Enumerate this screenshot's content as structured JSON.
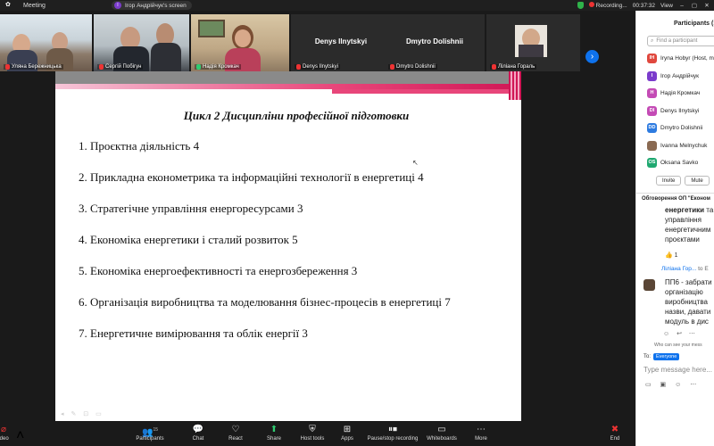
{
  "window": {
    "title": "Meeting",
    "share_label": "Ігор Андрійчук's screen",
    "share_initial": "I",
    "recording": "Recording...",
    "timer": "00:37:32",
    "view": "View"
  },
  "thumbnails": [
    {
      "name": "Уляна Бережницька"
    },
    {
      "name": "Сергій Побігун"
    },
    {
      "name": "Надія Кромкач"
    },
    {
      "name": "Denys Ilnytskyi",
      "big": "Denys Ilnytskyi"
    },
    {
      "name": "Dmytro Dolishnii",
      "big": "Dmytro Dolishnii"
    },
    {
      "name": "Ліліана Гораль"
    }
  ],
  "slide": {
    "title": "Цикл 2 Дисципліни професійної підготовки",
    "items": [
      "1. Проєктна діяльність 4",
      "2. Прикладна економетрика та інформаційні технології в енергетиці 4",
      "3. Стратегічне управління енергоресурсами 3",
      "4. Економіка енергетики і  сталий розвиток 5",
      "5. Економіка енергоефективності та енергозбереження 3",
      "6. Організація виробництва та моделювання бізнес-процесів в енергетиці 7",
      "7. Енергетичне вимірювання та облік енергії 3"
    ]
  },
  "participants": {
    "title": "Participants (15",
    "search_placeholder": "Find a participant",
    "list": [
      {
        "initials": "IH",
        "name": "Iryna Hobyr (Host, m",
        "color": "#e0483e"
      },
      {
        "initials": "I",
        "name": "Ігор Андрійчук",
        "color": "#7b3ccc"
      },
      {
        "initials": "Н",
        "name": "Надія Кромкач",
        "color": "#c44bb5"
      },
      {
        "initials": "DI",
        "name": "Denys Ilnytskyi",
        "color": "#c44bb5"
      },
      {
        "initials": "DD",
        "name": "Dmytro Dolishnii",
        "color": "#2d7be0"
      },
      {
        "initials": "",
        "name": "Ivanna Melnychuk",
        "color": "#8a6a52"
      },
      {
        "initials": "OS",
        "name": "Oksana Savko",
        "color": "#1fa870"
      }
    ],
    "invite": "Invite",
    "mute": "Mute"
  },
  "chat": {
    "title": "Обговорення ОП \"Економ",
    "msg1_bold": "енергетики",
    "msg1_bold_tail": " та",
    "msg1_rest": [
      "управління",
      "енергетичним",
      "проєктами"
    ],
    "reaction": "👍 1",
    "sender": "Ліліана Гор...",
    "sender_to": "to E",
    "msg2": [
      "ПП6 - забрати",
      "організацію",
      "виробництва",
      "назви, давати",
      "модуль в дис"
    ],
    "who_can_see": "Who can see your mess",
    "to_label": "To:",
    "to_value": "Everyone",
    "type_placeholder": "Type message here..."
  },
  "toolbar": {
    "video": "ideo",
    "participants": "Participants",
    "participants_count": "15",
    "chat": "Chat",
    "react": "React",
    "share": "Share",
    "host_tools": "Host tools",
    "apps": "Apps",
    "pause_stop": "Pause/stop recording",
    "whiteboards": "Whiteboards",
    "more": "More",
    "end": "End"
  }
}
